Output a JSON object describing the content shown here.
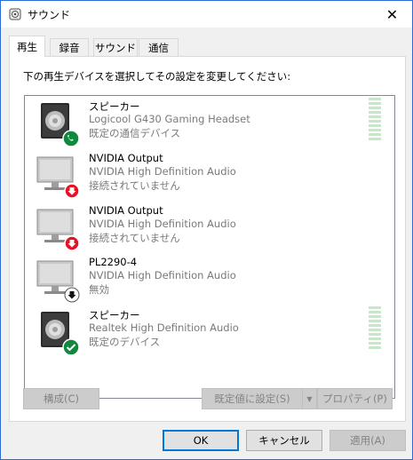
{
  "window": {
    "title": "サウンド",
    "close_glyph": "✕"
  },
  "tabs": [
    {
      "label": "再生",
      "active": true
    },
    {
      "label": "録音",
      "active": false
    },
    {
      "label": "サウンド",
      "active": false
    },
    {
      "label": "通信",
      "active": false
    }
  ],
  "panel": {
    "instruction": "下の再生デバイスを選択してその設定を変更してください:"
  },
  "devices": [
    {
      "name": "スピーカー",
      "driver": "Logicool G430 Gaming Headset",
      "status": "既定の通信デバイス",
      "icon": "speaker-icon",
      "badge": "phone-badge",
      "meter": true
    },
    {
      "name": "NVIDIA Output",
      "driver": "NVIDIA High Definition Audio",
      "status": "接続されていません",
      "icon": "monitor-icon",
      "badge": "red-down-arrow-badge",
      "meter": false
    },
    {
      "name": "NVIDIA Output",
      "driver": "NVIDIA High Definition Audio",
      "status": "接続されていません",
      "icon": "monitor-icon",
      "badge": "red-down-arrow-badge",
      "meter": false
    },
    {
      "name": "PL2290-4",
      "driver": "NVIDIA High Definition Audio",
      "status": "無効",
      "icon": "monitor-icon",
      "badge": "black-down-arrow-badge",
      "meter": false
    },
    {
      "name": "スピーカー",
      "driver": "Realtek High Definition Audio",
      "status": "既定のデバイス",
      "icon": "speaker-icon",
      "badge": "green-check-badge",
      "meter": true
    }
  ],
  "buttons": {
    "configure": "構成(C)",
    "set_default": "既定値に設定(S)",
    "properties": "プロパティ(P)",
    "ok": "OK",
    "cancel": "キャンセル",
    "apply": "適用(A)"
  },
  "colors": {
    "accent": "#0078d7",
    "meter_idle": "#c8e6c9",
    "phone_badge": "#10893e",
    "check_badge": "#10893e",
    "down_red": "#e81123"
  }
}
